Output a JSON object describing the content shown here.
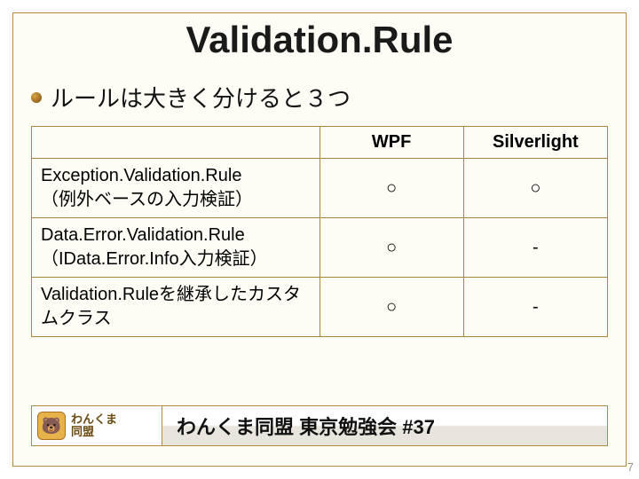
{
  "title": "Validation.Rule",
  "bullet": "ルールは大きく分けると３つ",
  "table": {
    "headers": {
      "blank": "",
      "col1": "WPF",
      "col2": "Silverlight"
    },
    "rows": [
      {
        "name": "Exception.Validation.Rule\n（例外ベースの入力検証）",
        "wpf": "○",
        "sl": "○"
      },
      {
        "name": "Data.Error.Validation.Rule\n（IData.Error.Info入力検証）",
        "wpf": "○",
        "sl": "-"
      },
      {
        "name": "Validation.Ruleを継承したカスタムクラス",
        "wpf": "○",
        "sl": "-"
      }
    ]
  },
  "footer": {
    "logo_line1": "わんくま",
    "logo_line2": "同盟",
    "mascot": "🐻",
    "event": "わんくま同盟 東京勉強会 #37"
  },
  "page_number": "7"
}
